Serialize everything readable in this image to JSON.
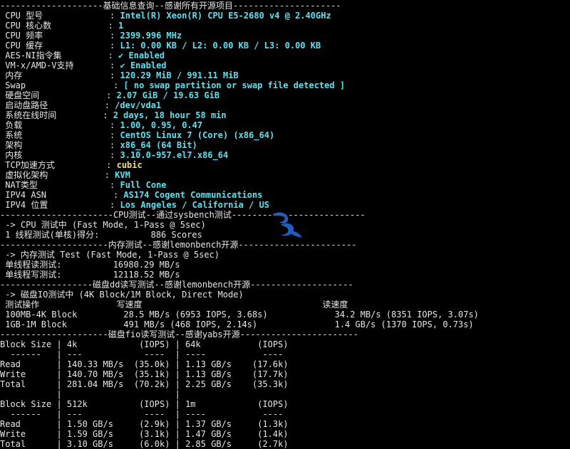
{
  "colors": {
    "background": "#000000",
    "text": "#e6e6e6",
    "value_cyan": "#4ee6f2",
    "value_yellow": "#f1e25b",
    "logo_blue": "#1f5fc4"
  },
  "icons": {
    "watermark": "blue-bird-logo"
  },
  "lines": [
    {
      "segs": [
        {
          "t": "--------------------基础信息查询--感谢所有开源项目---------------------",
          "c": "wht"
        }
      ]
    },
    {
      "segs": [
        {
          "t": " CPU 型号             : ",
          "c": "wht"
        },
        {
          "t": "Intel(R) Xeon(R) CPU E5-2680 v4 @ 2.40GHz",
          "c": "cyn"
        }
      ]
    },
    {
      "segs": [
        {
          "t": " CPU 核心数           : ",
          "c": "wht"
        },
        {
          "t": "1",
          "c": "cyn"
        }
      ]
    },
    {
      "segs": [
        {
          "t": " CPU 频率             : ",
          "c": "wht"
        },
        {
          "t": "2399.996 MHz",
          "c": "cyn"
        }
      ]
    },
    {
      "segs": [
        {
          "t": " CPU 缓存             : ",
          "c": "wht"
        },
        {
          "t": "L1: 0.00 KB / L2: 0.00 KB / L3: 0.00 KB",
          "c": "cyn"
        }
      ]
    },
    {
      "segs": [
        {
          "t": " AES-NI指令集         : ",
          "c": "wht"
        },
        {
          "t": "✔ Enabled",
          "c": "cyn"
        }
      ]
    },
    {
      "segs": [
        {
          "t": " VM-x/AMD-V支持       : ",
          "c": "wht"
        },
        {
          "t": "✔ Enabled",
          "c": "cyn"
        }
      ]
    },
    {
      "segs": [
        {
          "t": " 内存                 : ",
          "c": "wht"
        },
        {
          "t": "120.29 MiB / 991.11 MiB",
          "c": "cyn"
        }
      ]
    },
    {
      "segs": [
        {
          "t": " Swap                 : ",
          "c": "wht"
        },
        {
          "t": "[ no swap partition or swap file detected ]",
          "c": "cyn"
        }
      ]
    },
    {
      "segs": [
        {
          "t": " 硬盘空间             : ",
          "c": "wht"
        },
        {
          "t": "2.07 GiB / 19.63 GiB",
          "c": "cyn"
        }
      ]
    },
    {
      "segs": [
        {
          "t": " 启动盘路径           : ",
          "c": "wht"
        },
        {
          "t": "/dev/vda1",
          "c": "cyn"
        }
      ]
    },
    {
      "segs": [
        {
          "t": " 系统在线时间         : ",
          "c": "wht"
        },
        {
          "t": "2 days, 18 hour 58 min",
          "c": "cyn"
        }
      ]
    },
    {
      "segs": [
        {
          "t": " 负载                 : ",
          "c": "wht"
        },
        {
          "t": "1.00, 0.95, 0.47",
          "c": "cyn"
        }
      ]
    },
    {
      "segs": [
        {
          "t": " 系统                 : ",
          "c": "wht"
        },
        {
          "t": "CentOS Linux 7 (Core) (x86_64)",
          "c": "cyn"
        }
      ]
    },
    {
      "segs": [
        {
          "t": " 架构                 : ",
          "c": "wht"
        },
        {
          "t": "x86_64 (64 Bit)",
          "c": "cyn"
        }
      ]
    },
    {
      "segs": [
        {
          "t": " 内核                 : ",
          "c": "wht"
        },
        {
          "t": "3.10.0-957.el7.x86_64",
          "c": "cyn"
        }
      ]
    },
    {
      "segs": [
        {
          "t": " TCP加速方式          : ",
          "c": "wht"
        },
        {
          "t": "cubic",
          "c": "yel"
        }
      ]
    },
    {
      "segs": [
        {
          "t": " 虚拟化架构           : ",
          "c": "wht"
        },
        {
          "t": "KVM",
          "c": "cyn"
        }
      ]
    },
    {
      "segs": [
        {
          "t": " NAT类型              : ",
          "c": "wht"
        },
        {
          "t": "Full Cone",
          "c": "cyn"
        }
      ]
    },
    {
      "segs": [
        {
          "t": " IPV4 ASN             : ",
          "c": "wht"
        },
        {
          "t": "AS174 Cogent Communications",
          "c": "cyn"
        }
      ]
    },
    {
      "segs": [
        {
          "t": " IPV4 位置            : ",
          "c": "wht"
        },
        {
          "t": "Los Angeles / California / US",
          "c": "cyn"
        }
      ]
    },
    {
      "segs": [
        {
          "t": "----------------------CPU测试--通过sysbench测试--------------------------",
          "c": "wht"
        }
      ]
    },
    {
      "segs": [
        {
          "t": " -> CPU 测试中 (Fast Mode, 1-Pass @ 5sec)",
          "c": "wht"
        }
      ]
    },
    {
      "segs": [
        {
          "t": " 1 线程测试(单核)得分:          886 Scores",
          "c": "wht"
        }
      ]
    },
    {
      "segs": [
        {
          "t": "---------------------内存测试--感谢lemonbench开源-----------------------",
          "c": "wht"
        }
      ]
    },
    {
      "segs": [
        {
          "t": " -> 内存测试 Test (Fast Mode, 1-Pass @ 5sec)",
          "c": "wht"
        }
      ]
    },
    {
      "segs": [
        {
          "t": " 单线程读测试:          16980.29 MB/s",
          "c": "wht"
        }
      ]
    },
    {
      "segs": [
        {
          "t": " 单线程写测试:          12118.52 MB/s",
          "c": "wht"
        }
      ]
    },
    {
      "segs": [
        {
          "t": "------------------磁盘dd读写测试--感谢lemonbench开源--------------------",
          "c": "wht"
        }
      ]
    },
    {
      "segs": [
        {
          "t": " -> 磁盘IO测试中 (4K Block/1M Block, Direct Mode)",
          "c": "wht"
        }
      ]
    },
    {
      "segs": [
        {
          "t": " 测试操作               写速度                                   读速度",
          "c": "wht"
        }
      ]
    },
    {
      "segs": [
        {
          "t": " 100MB-4K Block         28.5 MB/s (6953 IOPS, 3.68s)             34.2 MB/s (8351 IOPS, 3.07s)",
          "c": "wht"
        }
      ]
    },
    {
      "segs": [
        {
          "t": " 1GB-1M Block           491 MB/s (468 IOPS, 2.14s)               1.4 GB/s (1370 IOPS, 0.73s)",
          "c": "wht"
        }
      ]
    },
    {
      "segs": [
        {
          "t": "---------------------磁盘fio读写测试--感谢yabs开源-----------------------",
          "c": "wht"
        }
      ]
    },
    {
      "segs": [
        {
          "t": "Block Size | 4k            (IOPS) | 64k           (IOPS)",
          "c": "wht"
        }
      ]
    },
    {
      "segs": [
        {
          "t": "  ------   | ---            ----  | ----           ----",
          "c": "wht"
        }
      ]
    },
    {
      "segs": [
        {
          "t": "Read       | 140.33 MB/s  (35.0k) | 1.13 GB/s    (17.6k)",
          "c": "wht"
        }
      ]
    },
    {
      "segs": [
        {
          "t": "Write      | 140.70 MB/s  (35.1k) | 1.13 GB/s    (17.7k)",
          "c": "wht"
        }
      ]
    },
    {
      "segs": [
        {
          "t": "Total      | 281.04 MB/s  (70.2k) | 2.25 GB/s    (35.3k)",
          "c": "wht"
        }
      ]
    },
    {
      "segs": [
        {
          "t": "           |                      |",
          "c": "wht"
        }
      ]
    },
    {
      "segs": [
        {
          "t": "Block Size | 512k          (IOPS) | 1m            (IOPS)",
          "c": "wht"
        }
      ]
    },
    {
      "segs": [
        {
          "t": "  ------   | ---            ----  | ----           ----",
          "c": "wht"
        }
      ]
    },
    {
      "segs": [
        {
          "t": "Read       | 1.50 GB/s     (2.9k) | 1.37 GB/s     (1.3k)",
          "c": "wht"
        }
      ]
    },
    {
      "segs": [
        {
          "t": "Write      | 1.59 GB/s     (3.1k) | 1.47 GB/s     (1.4k)",
          "c": "wht"
        }
      ]
    },
    {
      "segs": [
        {
          "t": "Total      | 3.10 GB/s     (6.0k) | 2.85 GB/s     (2.7k)",
          "c": "wht"
        }
      ]
    }
  ]
}
